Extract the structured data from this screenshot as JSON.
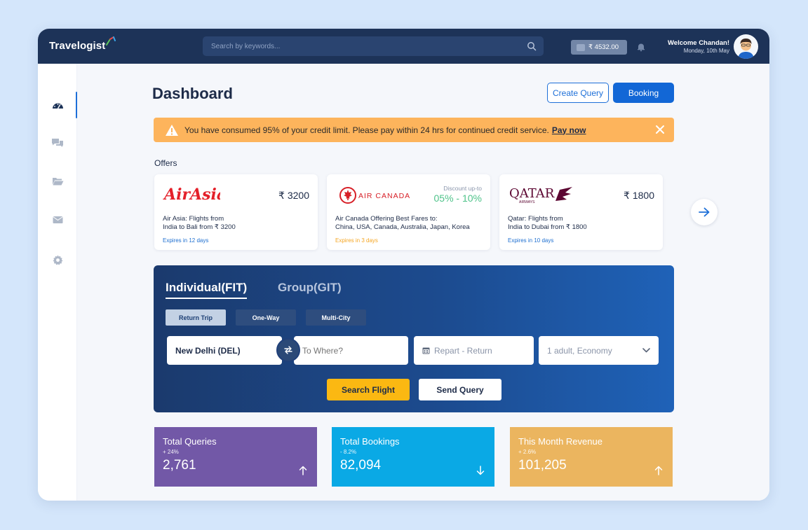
{
  "app": {
    "logo_text": "Travelogist",
    "search_placeholder": "Search by keywords...",
    "wallet_balance": "₹ 4532.00",
    "welcome_name": "Welcome Chandan!",
    "welcome_date": "Monday, 10th May"
  },
  "sidebar": {
    "items": [
      {
        "icon": "dashboard-icon",
        "active": true
      },
      {
        "icon": "chat-icon",
        "active": false
      },
      {
        "icon": "folder-icon",
        "active": false
      },
      {
        "icon": "mail-icon",
        "active": false
      },
      {
        "icon": "gear-icon",
        "active": false
      }
    ]
  },
  "header": {
    "title": "Dashboard",
    "create_query_label": "Create Query",
    "booking_label": "Booking"
  },
  "alert": {
    "message": "You have consumed 95% of your credit limit. Please pay within 24 hrs for continued credit service.",
    "link_label": "Pay now"
  },
  "offers": {
    "label": "Offers",
    "cards": [
      {
        "brand": "AirAsia",
        "price": "₹ 3200",
        "description_line1": "Air Asia: Flights from",
        "description_line2": "India to Bali from ₹ 3200",
        "expiry": "Expires in 12 days",
        "expiry_color": "#1e6fd0"
      },
      {
        "brand": "AIR CANADA",
        "discount_label": "Discount up-to",
        "discount": "05% - 10%",
        "description_line1": "Air Canada Offering Best Fares to:",
        "description_line2": "China, USA, Canada, Australia, Japan, Korea",
        "expiry": "Expires in 3 days",
        "expiry_color": "#f5a623"
      },
      {
        "brand": "QATAR",
        "brand_sub": "AIRWAYS",
        "price": "₹ 1800",
        "description_line1": "Qatar: Flights from",
        "description_line2": "India to Dubai from ₹ 1800",
        "expiry": "Expires in 10 days",
        "expiry_color": "#1e6fd0"
      }
    ]
  },
  "search_panel": {
    "tabs": [
      "Individual(FIT)",
      "Group(GIT)"
    ],
    "active_tab": "Individual(FIT)",
    "trip_types": [
      "Return Trip",
      "One-Way",
      "Multi-City"
    ],
    "active_trip_type": "Return Trip",
    "from_value": "New Delhi (DEL)",
    "to_placeholder": "To Where?",
    "date_placeholder": "Repart - Return",
    "passengers": "1 adult, Economy",
    "search_button": "Search Flight",
    "query_button": "Send Query"
  },
  "stats": [
    {
      "title": "Total Queries",
      "change": "+ 24%",
      "value": "2,761",
      "direction": "up",
      "color": "#7258a7"
    },
    {
      "title": "Total Bookings",
      "change": "- 8.2%",
      "value": "82,094",
      "direction": "down",
      "color": "#0aa9e5"
    },
    {
      "title": "This Month Revenue",
      "change": "+ 2.6%",
      "value": "101,205",
      "direction": "up",
      "color": "#ebb55f"
    }
  ]
}
